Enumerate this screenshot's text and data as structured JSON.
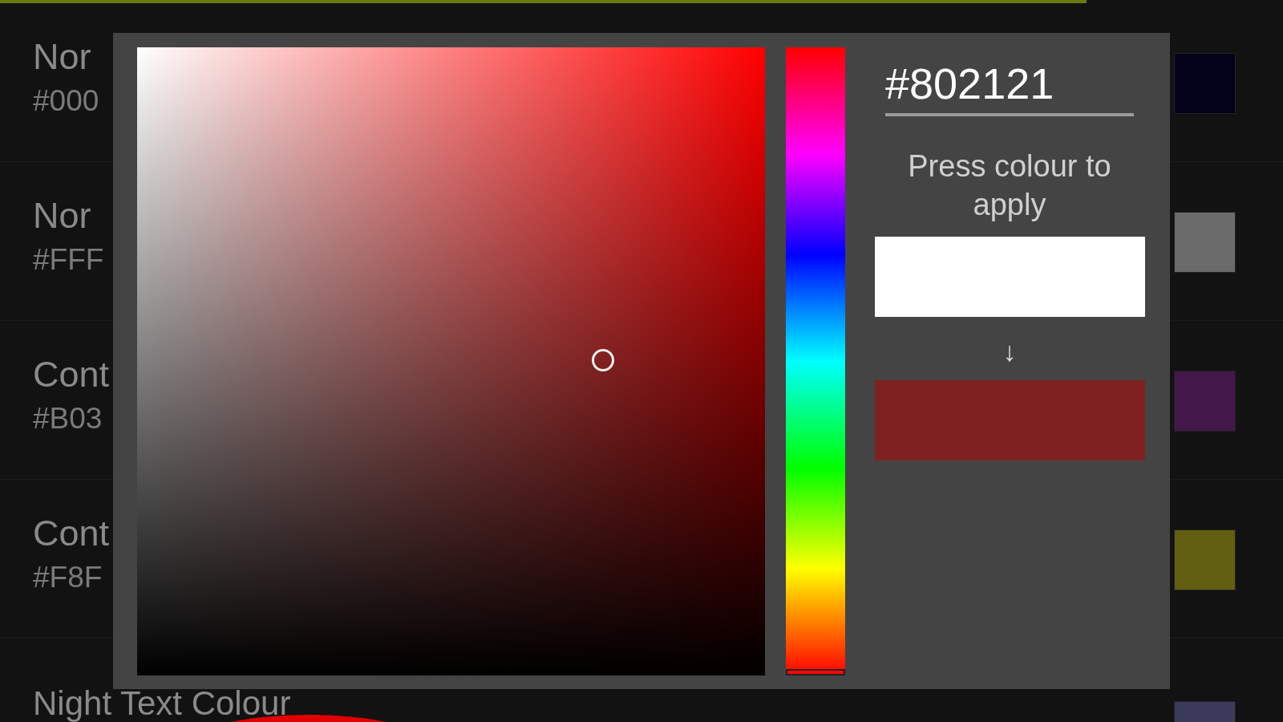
{
  "settings_rows": [
    {
      "label": "Nor",
      "value": "#000",
      "color": "#03021a"
    },
    {
      "label": "Nor",
      "value": "#FFF",
      "color": "#6b6b6b"
    },
    {
      "label": "Cont",
      "value": "#B03",
      "color": "#44174a"
    },
    {
      "label": "Cont",
      "value": "#F8F",
      "color": "#625e12"
    },
    {
      "label": "Night Text Colour",
      "color": "#3c3a5a"
    }
  ],
  "colour_picker": {
    "hex_field": {
      "value": "#802121"
    },
    "hue_slider": {
      "level": 0
    },
    "hint": "Press colour to apply",
    "arrow": "↓",
    "old_colour": {
      "color": "#ffffff"
    },
    "new_colour": {
      "color": "#802121"
    }
  }
}
